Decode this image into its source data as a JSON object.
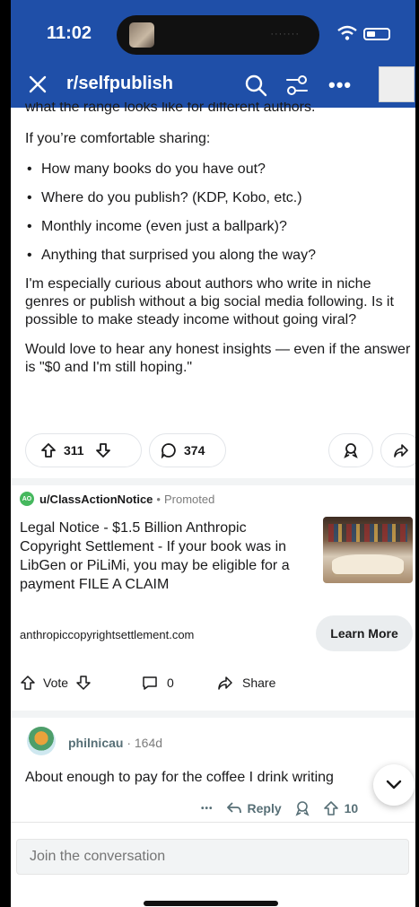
{
  "status": {
    "time": "11:02"
  },
  "nav": {
    "title": "r/selfpublish"
  },
  "post": {
    "cut_line": "what the range looks like for different authors.",
    "intro": "If you’re comfortable sharing:",
    "bullets": [
      "How many books do you have out?",
      "Where do you publish? (KDP, Kobo, etc.)",
      "Monthly income (even just a ballpark)?",
      "Anything that surprised you along the way?"
    ],
    "para1": "I'm especially curious about authors who write in niche genres or publish without a big social media following. Is it possible to make steady income without going viral?",
    "para2": "Would love to hear any honest insights — even if the answer is \"$0 and I'm still hoping.\"",
    "upvotes": "311",
    "comments": "374"
  },
  "ad": {
    "logo_text": "AO",
    "user": "u/ClassActionNotice",
    "dot": "•",
    "promoted": "Promoted",
    "text": "Legal Notice - $1.5 Billion Anthropic Copyright Settlement - If your book was in LibGen or PiLiMi, you may be eligible for a payment FILE A CLAIM",
    "url": "anthropiccopyrightsettlement.com",
    "cta": "Learn More",
    "vote_label": "Vote",
    "comment_count": "0",
    "share_label": "Share"
  },
  "comment": {
    "user": "philnicau",
    "age": "· 164d",
    "text": "About enough to pay for the coffee I drink writing",
    "more": "•••",
    "reply_label": "Reply",
    "votes": "10"
  },
  "composer": {
    "placeholder": "Join the conversation"
  }
}
